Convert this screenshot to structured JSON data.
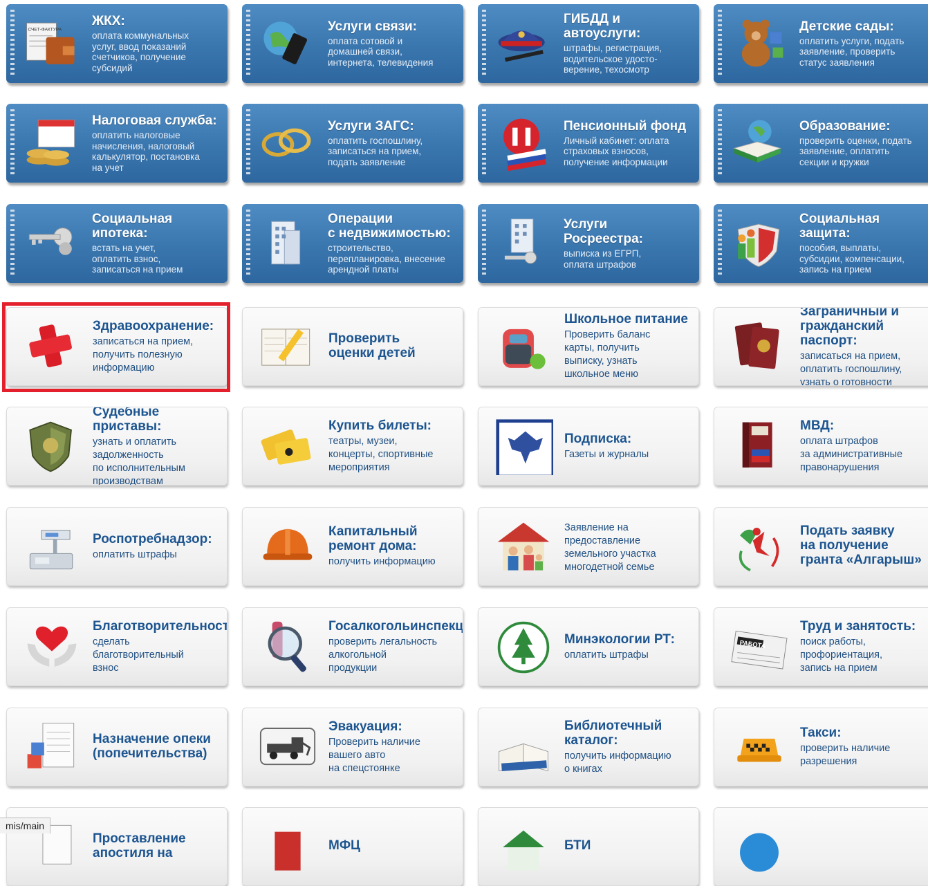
{
  "tiles": [
    {
      "title": "ЖКХ:",
      "desc": "оплата коммунальных\nуслуг, ввод показаний\nсчетчиков, получение\nсубсидий",
      "icon": "bill-wallet-icon",
      "icon_label": "СЧЕТ-ФАКТУРА"
    },
    {
      "title": "Услуги связи:",
      "desc": "оплата сотовой и\nдомашней связи,\nинтернета, телевидения",
      "icon": "globe-phone-icon"
    },
    {
      "title": "ГИБДД и автоуслуги:",
      "desc": "штрафы, регистрация,\nводительское удосто-\nверение, техосмотр",
      "icon": "police-cap-icon"
    },
    {
      "title": "Детские сады:",
      "desc": "оплатить услуги, подать\nзаявление, проверить\nстатус заявления",
      "icon": "teddy-bear-icon"
    },
    {
      "title": "Налоговая служба:",
      "desc": "оплатить налоговые\nначисления, налоговый\nкалькулятор, постановка\nна учет",
      "icon": "coins-calendar-icon"
    },
    {
      "title": "Услуги ЗАГС:",
      "desc": "оплатить госпошлину,\nзаписаться на прием,\nподать заявление",
      "icon": "wedding-rings-icon"
    },
    {
      "title": "Пенсионный фонд",
      "desc": "Личный кабинет: оплата\nстраховых взносов,\nполучение информации",
      "icon": "pension-fund-logo-icon"
    },
    {
      "title": "Образование:",
      "desc": "проверить оценки, подать\nзаявление, оплатить\nсекции и кружки",
      "icon": "globe-book-icon"
    },
    {
      "title": "Социальная\nипотека:",
      "desc": "встать на учет,\nоплатить взнос,\nзаписаться на прием",
      "icon": "keys-icon"
    },
    {
      "title": "Операции\nс недвижимостью:",
      "desc": "строительство,\nперепланировка, внесение\nарендной платы",
      "icon": "building-icon"
    },
    {
      "title": "Услуги\nРосреестра:",
      "desc": "выписка из ЕГРП,\nоплата штрафов",
      "icon": "building-key-icon"
    },
    {
      "title": "Социальная защита:",
      "desc": "пособия, выплаты,\nсубсидии, компенсации,\nзапись на прием",
      "icon": "family-shield-icon"
    },
    {
      "title": "Здравоохранение:",
      "desc": "записаться на прием,\nполучить полезную\nинформацию",
      "icon": "red-cross-icon"
    },
    {
      "title": "Проверить\nоценки детей",
      "desc": "",
      "icon": "diary-pencil-icon"
    },
    {
      "title": "Школьное питание",
      "desc": "Проверить баланс\nкарты, получить\nвыписку, узнать\nшкольное меню",
      "icon": "backpack-apple-icon"
    },
    {
      "title": "Заграничный и\nгражданский\nпаспорт:",
      "desc": "записаться на прием,\nоплатить госпошлину,\nузнать о готовности",
      "icon": "passport-icon"
    },
    {
      "title": "Судебные приставы:",
      "desc": "узнать и оплатить\nзадолженность\nпо исполнительным\nпроизводствам",
      "icon": "bailiff-badge-icon"
    },
    {
      "title": "Купить билеты:",
      "desc": "театры, музеи,\nконцерты, спортивные\nмероприятия",
      "icon": "tickets-icon"
    },
    {
      "title": "Подписка:",
      "desc": "Газеты и журналы",
      "icon": "post-eagle-icon"
    },
    {
      "title": "МВД:",
      "desc": "оплата штрафов\nза административные\nправонарушения",
      "icon": "code-book-icon"
    },
    {
      "title": "Роспотребнадзор:",
      "desc": "оплатить штрафы",
      "icon": "scales-icon"
    },
    {
      "title": "Капитальный\nремонт дома:",
      "desc": "получить информацию",
      "icon": "hard-hat-icon"
    },
    {
      "title": "",
      "desc": "Заявление на\nпредоставление\nземельного участка\nмногодетной семье",
      "icon": "family-house-icon"
    },
    {
      "title": "Подать заявку\nна получение\nгранта «Алгарыш»",
      "desc": "",
      "icon": "algarysh-logo-icon"
    },
    {
      "title": "Благотворительность:",
      "desc": "сделать\nблаготворительный\nвзнос",
      "icon": "heart-hands-icon"
    },
    {
      "title": "Госалкогольинспекция:",
      "desc": "проверить легальность\nалкогольной\nпродукции",
      "icon": "magnifier-bottle-icon"
    },
    {
      "title": "Минэкологии РТ:",
      "desc": "оплатить штрафы",
      "icon": "ecology-emblem-icon"
    },
    {
      "title": "Труд и занятость:",
      "desc": "поиск работы,\nпрофориентация,\nзапись на прием",
      "icon": "newspaper-icon",
      "icon_label": "РАБОТА"
    },
    {
      "title": "Назначение опеки\n(попечительства)",
      "desc": "",
      "icon": "document-blocks-icon"
    },
    {
      "title": "Эвакуация:",
      "desc": "Проверить наличие\nвашего авто\nна спецстоянке",
      "icon": "tow-truck-icon"
    },
    {
      "title": "Библиотечный\nкаталог:",
      "desc": "получить информацию\nо книгах",
      "icon": "open-book-icon"
    },
    {
      "title": "Такси:",
      "desc": "проверить наличие\nразрешения",
      "icon": "taxi-sign-icon"
    },
    {
      "title": "Проставление\nапостиля на",
      "desc": "",
      "icon": "document-icon"
    },
    {
      "title": "МФЦ",
      "desc": "",
      "icon": "mfc-logo-icon"
    },
    {
      "title": "БТИ",
      "desc": "",
      "icon": "house-icon"
    },
    {
      "title": "",
      "desc": "",
      "icon": "globe-icon"
    }
  ],
  "status_url": "mis/main",
  "colors": {
    "blue_tile": "#3a76ae",
    "white_tile": "#f1f1f1",
    "link_text": "#1d5590",
    "highlight": "#e3202b"
  }
}
